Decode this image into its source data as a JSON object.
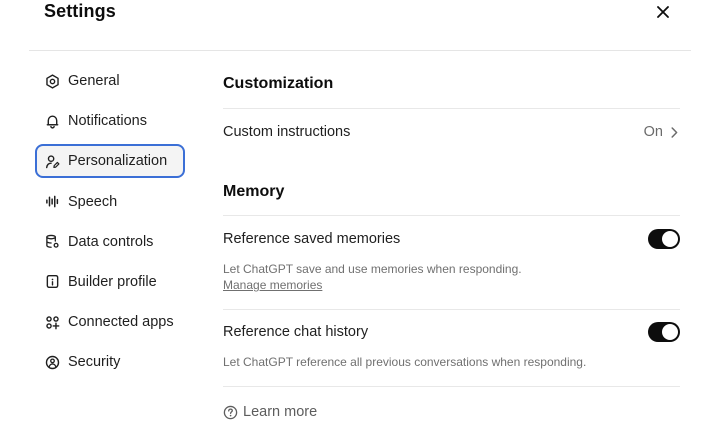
{
  "header": {
    "title": "Settings",
    "close_icon": "close-icon"
  },
  "sidebar": {
    "items": [
      {
        "label": "General",
        "icon": "gear-icon",
        "active": false
      },
      {
        "label": "Notifications",
        "icon": "bell-icon",
        "active": false
      },
      {
        "label": "Personalization",
        "icon": "person-edit-icon",
        "active": true
      },
      {
        "label": "Speech",
        "icon": "waveform-icon",
        "active": false
      },
      {
        "label": "Data controls",
        "icon": "database-settings-icon",
        "active": false
      },
      {
        "label": "Builder profile",
        "icon": "id-card-icon",
        "active": false
      },
      {
        "label": "Connected apps",
        "icon": "apps-grid-icon",
        "active": false
      },
      {
        "label": "Security",
        "icon": "lock-shield-icon",
        "active": false
      }
    ]
  },
  "main": {
    "customization": {
      "title": "Customization",
      "custom_instructions": {
        "label": "Custom instructions",
        "value": "On"
      }
    },
    "memory": {
      "title": "Memory",
      "reference_saved_memories": {
        "label": "Reference saved memories",
        "description": "Let ChatGPT save and use memories when responding.",
        "link": "Manage memories",
        "enabled": true
      },
      "reference_chat_history": {
        "label": "Reference chat history",
        "description": "Let ChatGPT reference all previous conversations when responding.",
        "enabled": true
      }
    },
    "learn_more": "Learn more"
  },
  "colors": {
    "accent_border": "#3b6fd6",
    "toggle_on": "#0d0d0d"
  }
}
